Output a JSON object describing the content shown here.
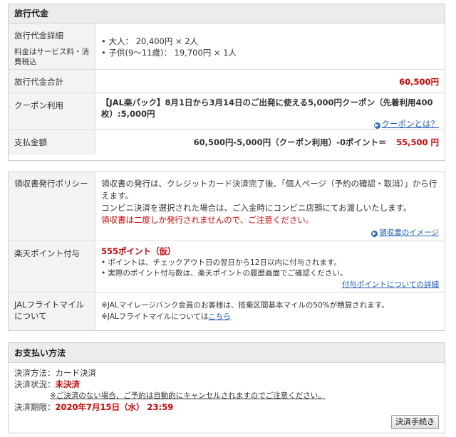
{
  "fees": {
    "title": "旅行代金",
    "details_label": "旅行代金詳細",
    "details_note": "料金はサービス料・消費税込",
    "items": [
      "大人： 20,400円 × 2人",
      "子供(9〜11歳)： 19,700円 × 1人"
    ],
    "total_label": "旅行代金合計",
    "total_value": "60,500円",
    "coupon_label": "クーポン利用",
    "coupon_text": "【JAL楽パック】8月1日から3月14日のご出発に使える5,000円クーポン（先着利用400枚）:5,000円",
    "coupon_link": "クーポンとは？",
    "pay_label": "支払金額",
    "pay_formula": "60,500円-5,000円（クーポン利用）-0ポイント＝",
    "pay_value": "55,500 円"
  },
  "policy": {
    "receipt_label": "領収書発行ポリシー",
    "receipt_text1": "領収書の発行は、クレジットカード決済完了後、「個人ページ（予約の確認・取消）」から行えます。",
    "receipt_text2": "コンビニ決済を選択された場合は、ご入金時にコンビニ店頭にてお渡しいたします。",
    "receipt_warning": "領収書は二度しか発行されませんので、ご注意ください。",
    "receipt_link": "領収書のイメージ",
    "points_label": "楽天ポイント付与",
    "points_value": "555ポイント（仮）",
    "points_items": [
      "ポイントは、チェックアウト日の翌日から12日以内に付与されます。",
      "実際のポイント付与数は、楽天ポイントの履歴画面でご確認ください。"
    ],
    "points_link": "付与ポイントについての詳細",
    "jal_label": "JALフライトマイルについて",
    "jal_text1": "※JALマイレージバンク会員のお客様は、搭乗区間基本マイルの50%が積算されます。",
    "jal_text2": "※JALフライトマイルについては",
    "jal_link": "こちら"
  },
  "payment": {
    "title": "お支払い方法",
    "method_label": "決済方法：",
    "method_value": "カード決済",
    "status_label": "決済状況：",
    "status_value": "未決済",
    "status_note": "※ご決済のない場合、ご予約は自動的にキャンセルされますのでご注意ください。",
    "deadline_label": "決済期限：",
    "deadline_value": "2020年7月15日（水） 23:59",
    "button": "決済手続き"
  }
}
